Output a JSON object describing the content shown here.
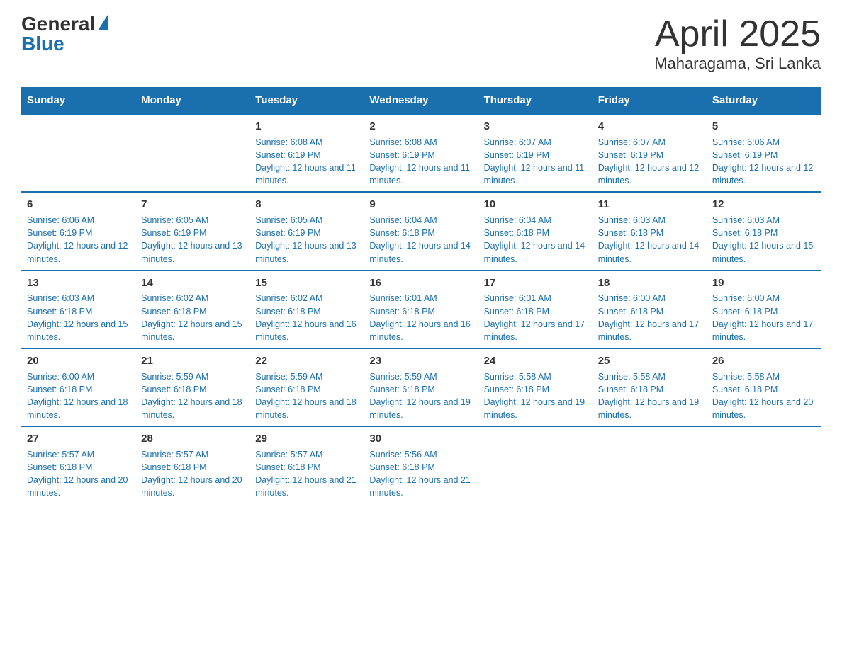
{
  "logo": {
    "general": "General",
    "blue": "Blue"
  },
  "title": "April 2025",
  "subtitle": "Maharagama, Sri Lanka",
  "days_of_week": [
    "Sunday",
    "Monday",
    "Tuesday",
    "Wednesday",
    "Thursday",
    "Friday",
    "Saturday"
  ],
  "weeks": [
    [
      {
        "day": "",
        "info": ""
      },
      {
        "day": "",
        "info": ""
      },
      {
        "day": "1",
        "info": "Sunrise: 6:08 AM\nSunset: 6:19 PM\nDaylight: 12 hours and 11 minutes."
      },
      {
        "day": "2",
        "info": "Sunrise: 6:08 AM\nSunset: 6:19 PM\nDaylight: 12 hours and 11 minutes."
      },
      {
        "day": "3",
        "info": "Sunrise: 6:07 AM\nSunset: 6:19 PM\nDaylight: 12 hours and 11 minutes."
      },
      {
        "day": "4",
        "info": "Sunrise: 6:07 AM\nSunset: 6:19 PM\nDaylight: 12 hours and 12 minutes."
      },
      {
        "day": "5",
        "info": "Sunrise: 6:06 AM\nSunset: 6:19 PM\nDaylight: 12 hours and 12 minutes."
      }
    ],
    [
      {
        "day": "6",
        "info": "Sunrise: 6:06 AM\nSunset: 6:19 PM\nDaylight: 12 hours and 12 minutes."
      },
      {
        "day": "7",
        "info": "Sunrise: 6:05 AM\nSunset: 6:19 PM\nDaylight: 12 hours and 13 minutes."
      },
      {
        "day": "8",
        "info": "Sunrise: 6:05 AM\nSunset: 6:19 PM\nDaylight: 12 hours and 13 minutes."
      },
      {
        "day": "9",
        "info": "Sunrise: 6:04 AM\nSunset: 6:18 PM\nDaylight: 12 hours and 14 minutes."
      },
      {
        "day": "10",
        "info": "Sunrise: 6:04 AM\nSunset: 6:18 PM\nDaylight: 12 hours and 14 minutes."
      },
      {
        "day": "11",
        "info": "Sunrise: 6:03 AM\nSunset: 6:18 PM\nDaylight: 12 hours and 14 minutes."
      },
      {
        "day": "12",
        "info": "Sunrise: 6:03 AM\nSunset: 6:18 PM\nDaylight: 12 hours and 15 minutes."
      }
    ],
    [
      {
        "day": "13",
        "info": "Sunrise: 6:03 AM\nSunset: 6:18 PM\nDaylight: 12 hours and 15 minutes."
      },
      {
        "day": "14",
        "info": "Sunrise: 6:02 AM\nSunset: 6:18 PM\nDaylight: 12 hours and 15 minutes."
      },
      {
        "day": "15",
        "info": "Sunrise: 6:02 AM\nSunset: 6:18 PM\nDaylight: 12 hours and 16 minutes."
      },
      {
        "day": "16",
        "info": "Sunrise: 6:01 AM\nSunset: 6:18 PM\nDaylight: 12 hours and 16 minutes."
      },
      {
        "day": "17",
        "info": "Sunrise: 6:01 AM\nSunset: 6:18 PM\nDaylight: 12 hours and 17 minutes."
      },
      {
        "day": "18",
        "info": "Sunrise: 6:00 AM\nSunset: 6:18 PM\nDaylight: 12 hours and 17 minutes."
      },
      {
        "day": "19",
        "info": "Sunrise: 6:00 AM\nSunset: 6:18 PM\nDaylight: 12 hours and 17 minutes."
      }
    ],
    [
      {
        "day": "20",
        "info": "Sunrise: 6:00 AM\nSunset: 6:18 PM\nDaylight: 12 hours and 18 minutes."
      },
      {
        "day": "21",
        "info": "Sunrise: 5:59 AM\nSunset: 6:18 PM\nDaylight: 12 hours and 18 minutes."
      },
      {
        "day": "22",
        "info": "Sunrise: 5:59 AM\nSunset: 6:18 PM\nDaylight: 12 hours and 18 minutes."
      },
      {
        "day": "23",
        "info": "Sunrise: 5:59 AM\nSunset: 6:18 PM\nDaylight: 12 hours and 19 minutes."
      },
      {
        "day": "24",
        "info": "Sunrise: 5:58 AM\nSunset: 6:18 PM\nDaylight: 12 hours and 19 minutes."
      },
      {
        "day": "25",
        "info": "Sunrise: 5:58 AM\nSunset: 6:18 PM\nDaylight: 12 hours and 19 minutes."
      },
      {
        "day": "26",
        "info": "Sunrise: 5:58 AM\nSunset: 6:18 PM\nDaylight: 12 hours and 20 minutes."
      }
    ],
    [
      {
        "day": "27",
        "info": "Sunrise: 5:57 AM\nSunset: 6:18 PM\nDaylight: 12 hours and 20 minutes."
      },
      {
        "day": "28",
        "info": "Sunrise: 5:57 AM\nSunset: 6:18 PM\nDaylight: 12 hours and 20 minutes."
      },
      {
        "day": "29",
        "info": "Sunrise: 5:57 AM\nSunset: 6:18 PM\nDaylight: 12 hours and 21 minutes."
      },
      {
        "day": "30",
        "info": "Sunrise: 5:56 AM\nSunset: 6:18 PM\nDaylight: 12 hours and 21 minutes."
      },
      {
        "day": "",
        "info": ""
      },
      {
        "day": "",
        "info": ""
      },
      {
        "day": "",
        "info": ""
      }
    ]
  ]
}
